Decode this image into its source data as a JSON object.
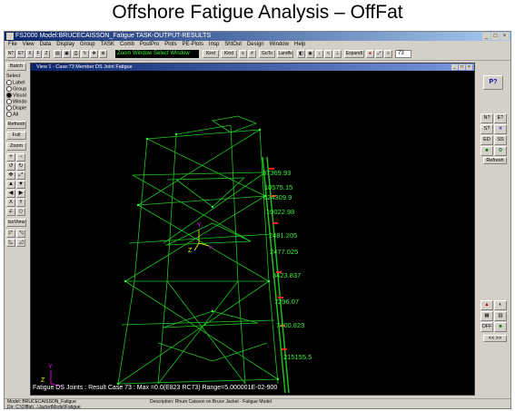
{
  "slide": {
    "title": "Offshore Fatigue  Analysis  – OffFat"
  },
  "window": {
    "title": "FS2000  Model:BRUCECAISSON_Fatigue  TASK-OUTPUT-RESULTS",
    "menu": [
      "File",
      "View",
      "Data",
      "Display",
      "Group",
      "TASK",
      "Comb",
      "PostPro",
      "Plots",
      "PE-Plots",
      "Insp",
      "ShtOut",
      "Design",
      "Window",
      "Help"
    ]
  },
  "toolbar": {
    "zoom_text": "Zoom Window   Select Window",
    "kind_label": "Kind",
    "angle_input": "73",
    "buttons": [
      "N?",
      "E?",
      "X",
      "F",
      "Z"
    ],
    "btn_labels": [
      "GoTo",
      "Landfs",
      "ExpandI"
    ]
  },
  "sidebar": {
    "batch": "Batch",
    "select_label": "Select",
    "radios": [
      {
        "label": "Label",
        "selected": false
      },
      {
        "label": "Group",
        "selected": false
      },
      {
        "label": "Visual",
        "selected": true
      },
      {
        "label": "Windo",
        "selected": false
      },
      {
        "label": "Disple",
        "selected": false
      },
      {
        "label": "All",
        "selected": false
      }
    ],
    "refresh": "Refresh",
    "full": "Full",
    "zoom": "Zoom",
    "isoview": "IsoView"
  },
  "view": {
    "title": "View 1 - Case:73 Member DS Joint Fatigue",
    "caption": "Fatigue DS Joints : Result Case   73 : Max =0.0(E823 RC73) Range=5.000001E-02-900",
    "axis": {
      "y": "Y",
      "z": "Z"
    },
    "labels": [
      "37369.93",
      "10575.15",
      "624309.9",
      "10022.98",
      "2481.205",
      "2477.025",
      "3423.837",
      "7296.07",
      "7400.823",
      "215155.5"
    ]
  },
  "right_panel": {
    "help": "P?",
    "refresh": "Refresh",
    "buttons_top": [
      "N?",
      "E?",
      "S?",
      "ED",
      "SS"
    ],
    "buttons_bottom": [
      "OFF"
    ],
    "nav": "<< >>"
  },
  "status": {
    "model": "Model:  BRUCECAISSON_Fatigue",
    "model2": "Dir: C:\\Offfat\\...\\JacketModel\\Fatigue",
    "description": "Description:  Rhum Caisson on Bruce Jacket - Fatigue Model"
  },
  "colors": {
    "wire": "#1ec81e",
    "label": "#3cf03c",
    "accent": "#0a246a",
    "marker": "#ff2020"
  }
}
